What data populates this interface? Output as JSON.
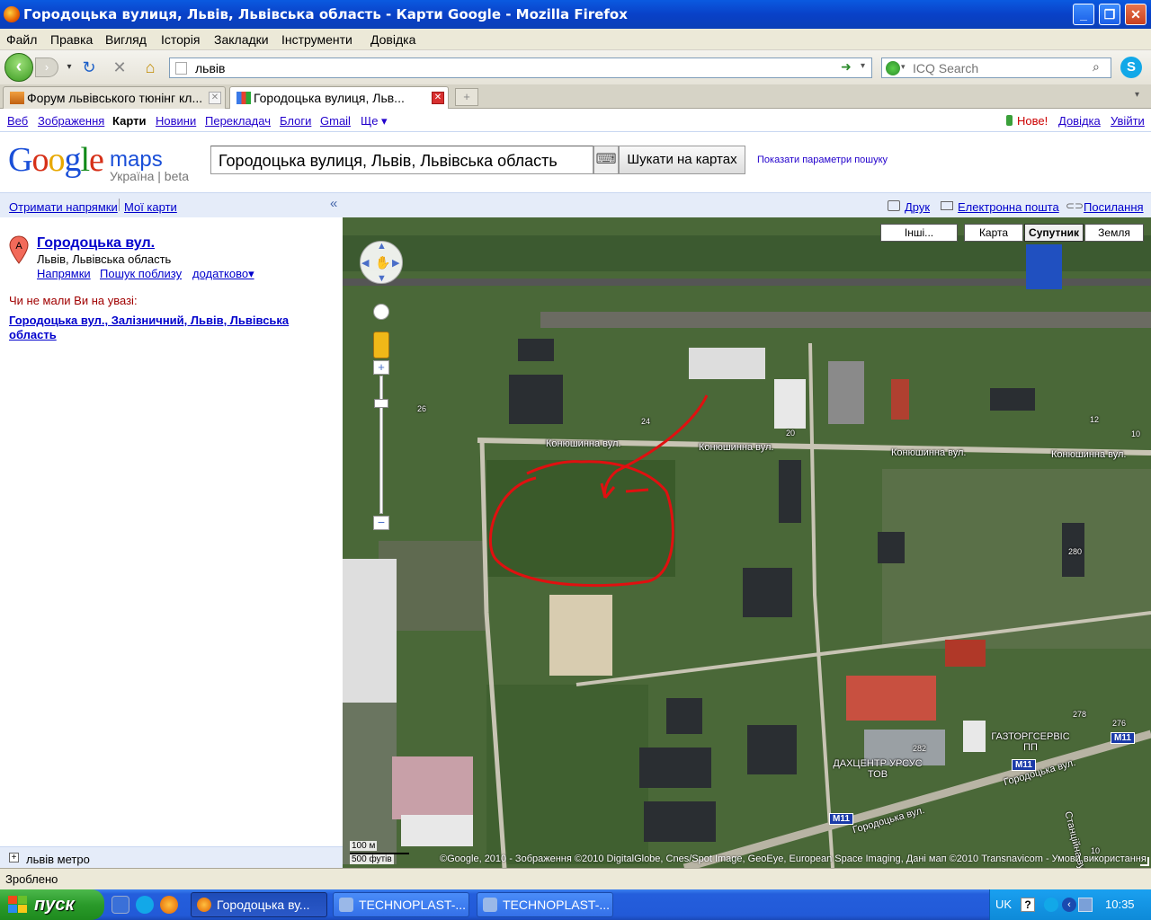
{
  "window": {
    "title": "Городоцька вулиця, Львів, Львівська область - Карти Google - Mozilla Firefox"
  },
  "menu": [
    "Файл",
    "Правка",
    "Вигляд",
    "Історія",
    "Закладки",
    "Інструменти",
    "Довідка"
  ],
  "nav": {
    "url": "львів",
    "search_placeholder": "ICQ Search"
  },
  "tabs": [
    {
      "label": "Форум львівського тюнінг кл...",
      "active": false
    },
    {
      "label": "Городоцька вулиця, Льв...",
      "active": true
    }
  ],
  "gbar": {
    "links": [
      "Веб",
      "Зображення",
      "Карти",
      "Новини",
      "Перекладач",
      "Блоги",
      "Gmail",
      "Ще ▾"
    ],
    "right": {
      "new": "Нове!",
      "help": "Довідка",
      "signin": "Увійти"
    }
  },
  "header": {
    "logo": "Google",
    "product": "maps",
    "sub": "Україна | beta",
    "query": "Городоцька вулиця, Львів, Львівська область",
    "search_button": "Шукати на картах",
    "show_options": "Показати параметри пошуку"
  },
  "linkbar": {
    "directions": "Отримати напрямки",
    "my_maps": "Мої карти",
    "collapse": "«",
    "print": "Друк",
    "email": "Електронна пошта",
    "link": "Посилання"
  },
  "result": {
    "marker": "A",
    "title": "Городоцька вул.",
    "address": "Львів, Львівська область",
    "links": [
      "Напрямки",
      "Пошук поблизу",
      "додатково▾"
    ],
    "did_you_mean": "Чи не мали Ви на увазі:",
    "suggestion": "Городоцька вул., Залізничний, Львів, Львівська область"
  },
  "left_footer": "львів метро",
  "map": {
    "types": [
      "Інші...",
      "Карта",
      "Супутник",
      "Земля"
    ],
    "active_type": "Супутник",
    "road_labels": [
      "Конюшинна вул.",
      "Конюшинна вул.",
      "Конюшинна вул.",
      "Конюшинна вул.",
      "Городоцька вул.",
      "Городоцька вул.",
      "Станційна вул."
    ],
    "place_labels": [
      "ГАЗТОРГСЕРВІС ПП",
      "ДАХЦЕНТР УРСУС ТОВ"
    ],
    "house_numbers": [
      "26",
      "24",
      "20",
      "12",
      "10",
      "280",
      "282",
      "278",
      "276",
      "10"
    ],
    "shields": [
      "M11",
      "M11",
      "M11"
    ],
    "scale": {
      "metric": "100 м",
      "imperial": "500 футів"
    },
    "copyright": "©Google, 2010 - Зображення ©2010 DigitalGlobe, Cnes/Spot Image, GeoEye, European Space Imaging, Дані мап ©2010 Transnavicom - Умови використання"
  },
  "status": "Зроблено",
  "taskbar": {
    "start": "пуск",
    "tasks": [
      "Городоцька ву...",
      "TECHNOPLAST-...",
      "TECHNOPLAST-..."
    ],
    "lang": "UK",
    "time": "10:35"
  },
  "colors": {
    "accent": "#2200cc",
    "annotation": "#e01010",
    "did_you_mean": "#a00000"
  }
}
